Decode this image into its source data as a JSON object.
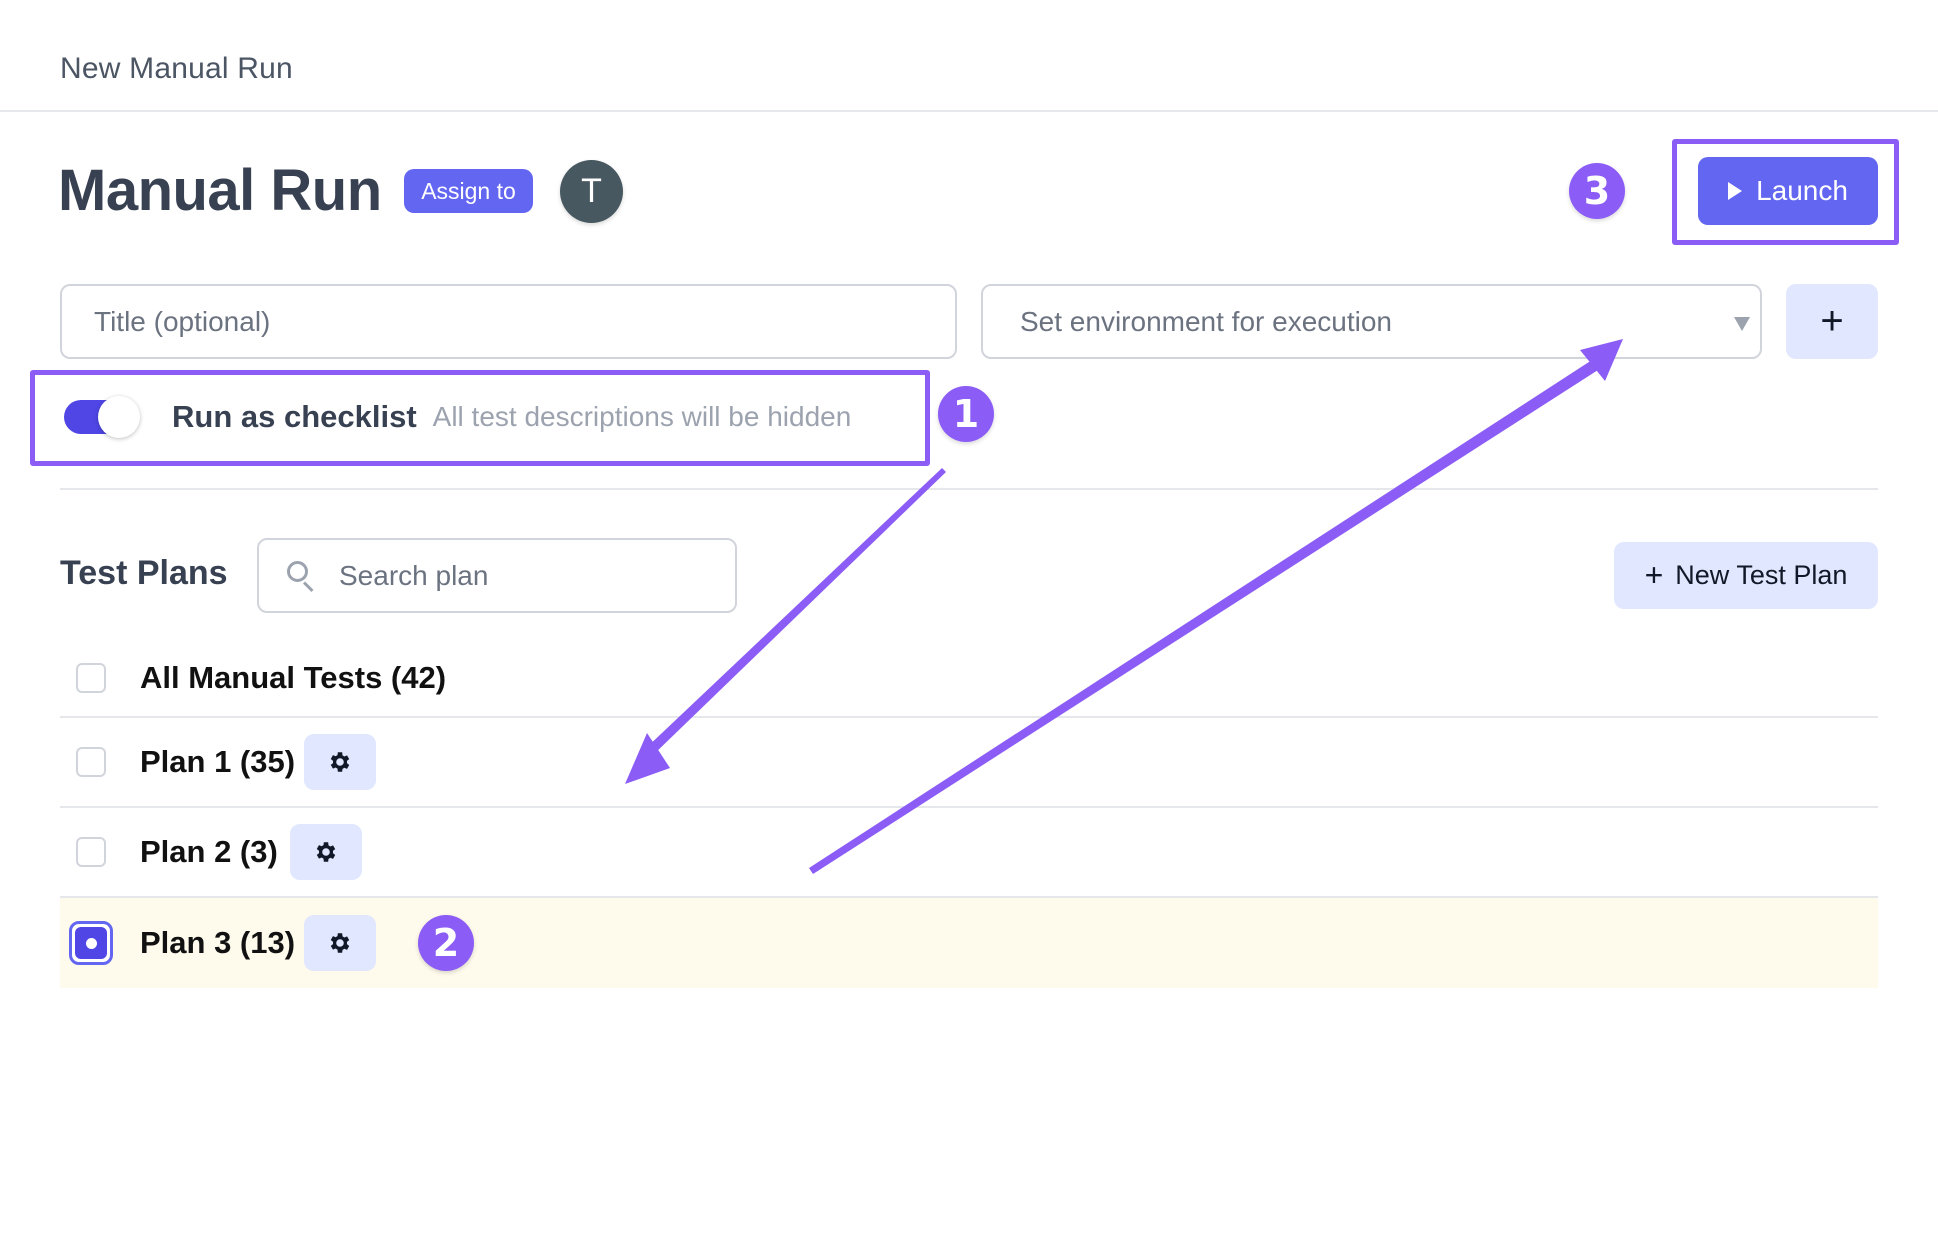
{
  "header": {
    "title": "New Manual Run"
  },
  "run": {
    "title": "Manual Run",
    "assign_label": "Assign to",
    "assignee_initial": "T",
    "launch_label": "Launch"
  },
  "form": {
    "title_placeholder": "Title (optional)",
    "title_value": "",
    "environment_placeholder": "Set environment for execution",
    "add_environment_label": "+"
  },
  "checklist": {
    "label": "Run as checklist",
    "hint": "All test descriptions will be hidden",
    "enabled": true
  },
  "test_plans": {
    "heading": "Test Plans",
    "search_placeholder": "Search plan",
    "new_plan_label": "New Test Plan",
    "items": [
      {
        "name": "All Manual Tests (42)",
        "checked": false,
        "has_settings": false
      },
      {
        "name": "Plan 1 (35)",
        "checked": false,
        "has_settings": true
      },
      {
        "name": "Plan 2 (3)",
        "checked": false,
        "has_settings": true
      },
      {
        "name": "Plan 3 (13)",
        "checked": true,
        "has_settings": true
      }
    ]
  },
  "annotations": {
    "color": "#8b5cf6",
    "badges": [
      "1",
      "2",
      "3"
    ]
  },
  "colors": {
    "primary": "#6366f1",
    "toggle_on": "#4f46e5",
    "secondary_button": "#e0e7ff",
    "selected_row": "#fefaec",
    "annotation": "#8b5cf6"
  }
}
